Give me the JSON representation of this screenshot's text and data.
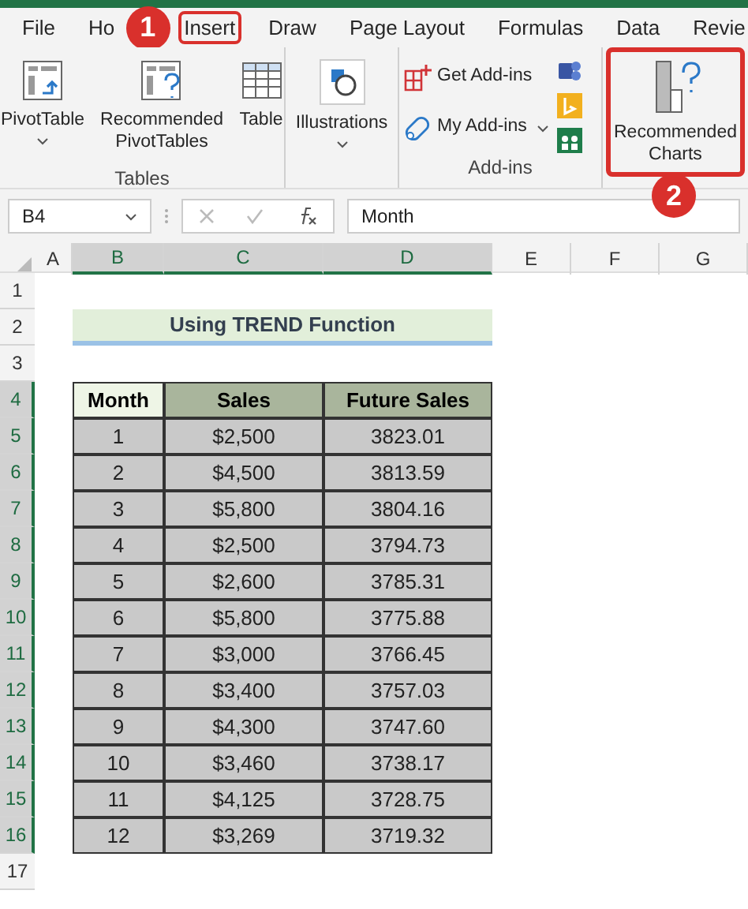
{
  "tabs": [
    {
      "label": "File",
      "selected": false
    },
    {
      "label": "Ho",
      "selected": false
    },
    {
      "label": "Insert",
      "selected": true
    },
    {
      "label": "Draw",
      "selected": false
    },
    {
      "label": "Page Layout",
      "selected": false
    },
    {
      "label": "Formulas",
      "selected": false
    },
    {
      "label": "Data",
      "selected": false
    },
    {
      "label": "Revie",
      "selected": false
    }
  ],
  "callouts": [
    {
      "label": "1"
    },
    {
      "label": "2"
    }
  ],
  "ribbon": {
    "groups": [
      {
        "label": "Tables",
        "buttons": [
          {
            "kind": "pivot",
            "label": "PivotTable",
            "dropdown": true,
            "highlighted": false
          },
          {
            "kind": "recpivot",
            "label": "Recommended PivotTables",
            "dropdown": false,
            "highlighted": false
          },
          {
            "kind": "table",
            "label": "Table",
            "dropdown": false,
            "highlighted": false
          }
        ]
      },
      {
        "buttons": [
          {
            "kind": "illustrations",
            "label": "Illustrations",
            "dropdown": true,
            "highlighted": false
          }
        ]
      },
      {
        "label": "Add-ins",
        "buttons": [
          {
            "kind": "addins",
            "label": "Get Add-ins",
            "dropdown": false,
            "highlighted": false
          },
          {
            "kind": "myaddins",
            "label": "My Add-ins",
            "dropdown": true,
            "highlighted": false
          }
        ]
      },
      {
        "buttons": [
          {
            "kind": "charts",
            "label": "Recommended Charts",
            "dropdown": false,
            "highlighted": true
          }
        ]
      }
    ]
  },
  "formula_bar": {
    "name_box": "B4",
    "value": "Month"
  },
  "columns": [
    {
      "label": "A",
      "selected": false
    },
    {
      "label": "B",
      "selected": true
    },
    {
      "label": "C",
      "selected": true
    },
    {
      "label": "D",
      "selected": true
    },
    {
      "label": "E",
      "selected": false
    },
    {
      "label": "F",
      "selected": false
    },
    {
      "label": "G",
      "selected": false
    }
  ],
  "row_numbers": [
    {
      "label": "1",
      "selected": false
    },
    {
      "label": "2",
      "selected": false
    },
    {
      "label": "3",
      "selected": false
    },
    {
      "label": "4",
      "selected": true
    },
    {
      "label": "5",
      "selected": true
    },
    {
      "label": "6",
      "selected": true
    },
    {
      "label": "7",
      "selected": true
    },
    {
      "label": "8",
      "selected": true
    },
    {
      "label": "9",
      "selected": true
    },
    {
      "label": "10",
      "selected": true
    },
    {
      "label": "11",
      "selected": true
    },
    {
      "label": "12",
      "selected": true
    },
    {
      "label": "13",
      "selected": true
    },
    {
      "label": "14",
      "selected": true
    },
    {
      "label": "15",
      "selected": true
    },
    {
      "label": "16",
      "selected": true
    },
    {
      "label": "17",
      "selected": false
    }
  ],
  "sheet": {
    "title": "Using TREND Function",
    "table": {
      "columns": [
        "Month",
        "Sales",
        "Future Sales"
      ],
      "rows": [
        [
          "1",
          "$2,500",
          "3823.01"
        ],
        [
          "2",
          "$4,500",
          "3813.59"
        ],
        [
          "3",
          "$5,800",
          "3804.16"
        ],
        [
          "4",
          "$2,500",
          "3794.73"
        ],
        [
          "5",
          "$2,600",
          "3785.31"
        ],
        [
          "6",
          "$5,800",
          "3775.88"
        ],
        [
          "7",
          "$3,000",
          "3766.45"
        ],
        [
          "8",
          "$3,400",
          "3757.03"
        ],
        [
          "9",
          "$4,300",
          "3747.60"
        ],
        [
          "10",
          "$3,460",
          "3738.17"
        ],
        [
          "11",
          "$4,125",
          "3728.75"
        ],
        [
          "12",
          "$3,269",
          "3719.32"
        ]
      ]
    }
  }
}
